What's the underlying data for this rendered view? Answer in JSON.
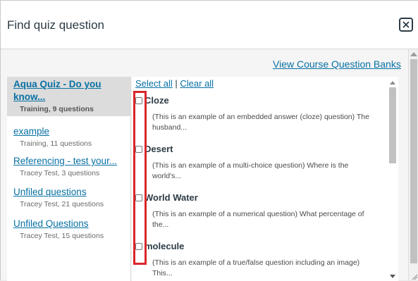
{
  "dialog": {
    "title": "Find quiz question",
    "close_icon": "close-icon",
    "view_banks_label": "View Course Question Banks"
  },
  "banks": [
    {
      "title": "Aqua Quiz - Do you know...",
      "meta": "Training, 9 questions",
      "active": true
    },
    {
      "title": "example",
      "meta": "Training, 11 questions",
      "active": false
    },
    {
      "title": "Referencing - test your...",
      "meta": "Tracey Test, 3 questions",
      "active": false
    },
    {
      "title": "Unfiled questions",
      "meta": "Tracey Test, 21 questions",
      "active": false
    },
    {
      "title": "Unfiled Questions",
      "meta": "Tracey Test, 15 questions",
      "active": false
    }
  ],
  "selection": {
    "select_all": "Select all",
    "separator": "|",
    "clear_all": "Clear all"
  },
  "questions": [
    {
      "name": "Cloze",
      "desc_line1": "(This is an example of an embedded answer (cloze) question) The",
      "desc_line2": "husband..."
    },
    {
      "name": "Desert",
      "desc_line1": "(This is an example of a multi-choice question) Where is the",
      "desc_line2": "world's..."
    },
    {
      "name": "World Water",
      "desc_line1": "(This is an example of a numerical question) What percentage of",
      "desc_line2": "the..."
    },
    {
      "name": "molecule",
      "desc_line1": "(This is an example of a true/false question including an image)",
      "desc_line2": "This..."
    }
  ],
  "colors": {
    "link": "#0770a3",
    "highlight": "#d9262c",
    "active_bank_bg": "#dcdcdc"
  }
}
